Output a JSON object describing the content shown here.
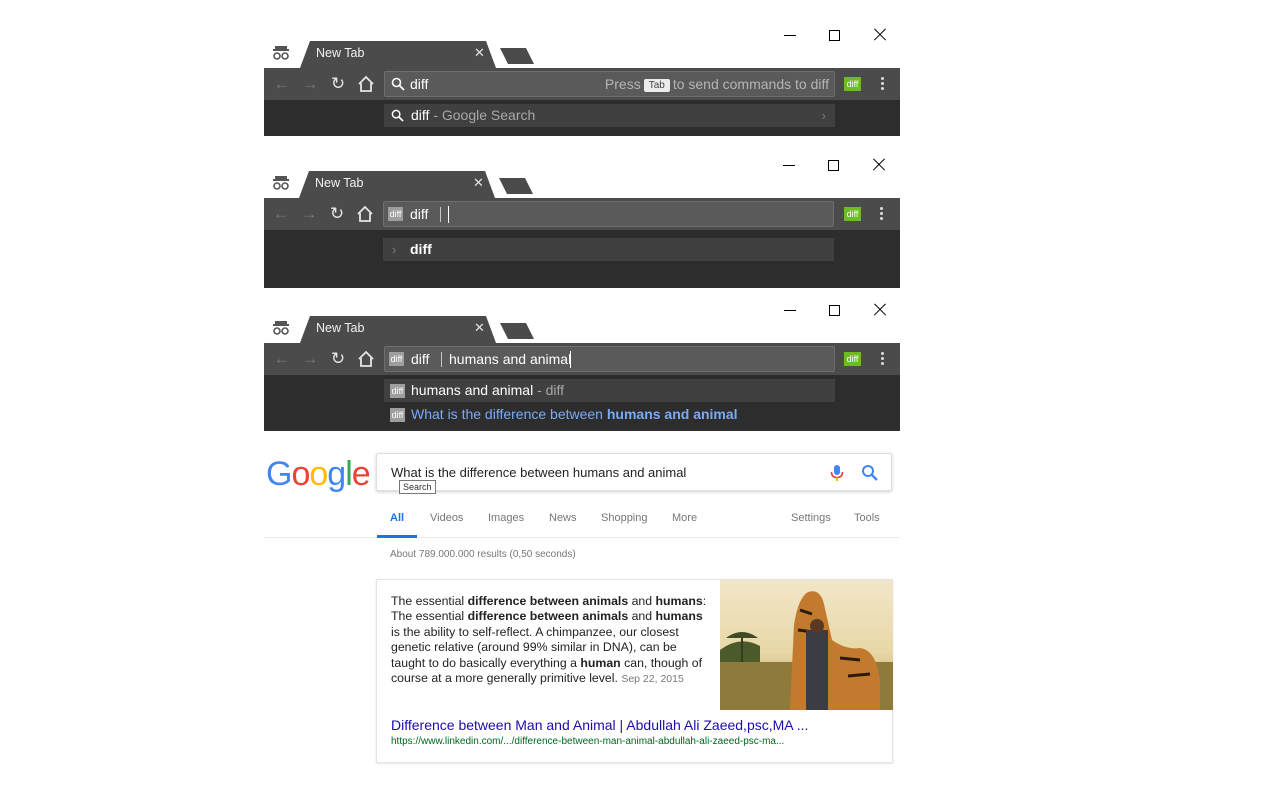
{
  "windows": [
    {
      "tab_title": "New Tab",
      "omnibox_text": "diff",
      "omnibox_hint_before": "Press",
      "omnibox_hint_key": "Tab",
      "omnibox_hint_after": "to send commands to diff",
      "extension_label": "diff",
      "suggestion_bold": "diff",
      "suggestion_rest": " - Google Search"
    },
    {
      "tab_title": "New Tab",
      "keyword_chip": "diff",
      "keyword_label": "diff",
      "extension_label": "diff",
      "suggestion": "diff"
    },
    {
      "tab_title": "New Tab",
      "keyword_chip": "diff",
      "keyword_label": "diff",
      "omnibox_query": "humans and animal",
      "extension_label": "diff",
      "suggestions": [
        {
          "chip": "diff",
          "text": "humans and animal",
          "suffix": " - diff"
        },
        {
          "chip": "diff",
          "prefix": "What is the difference between ",
          "bold": "humans and animal"
        }
      ]
    }
  ],
  "google": {
    "logo_letters": [
      "G",
      "o",
      "o",
      "g",
      "l",
      "e"
    ],
    "logo_colors": [
      "#4285f4",
      "#ea4335",
      "#fbbc05",
      "#4285f4",
      "#34a853",
      "#ea4335"
    ],
    "query": "What is the difference between humans and animal",
    "tooltip": "Search",
    "tabs": [
      "All",
      "Videos",
      "Images",
      "News",
      "Shopping",
      "More"
    ],
    "tools": [
      "Settings",
      "Tools"
    ],
    "stats": "About 789.000.000 results (0,50 seconds)",
    "snippet": {
      "parts": [
        {
          "t": "The essential ",
          "b": false
        },
        {
          "t": "difference between animals",
          "b": true
        },
        {
          "t": " and ",
          "b": false
        },
        {
          "t": "humans",
          "b": true
        },
        {
          "t": ": The essential ",
          "b": false
        },
        {
          "t": "difference between animals",
          "b": true
        },
        {
          "t": " and ",
          "b": false
        },
        {
          "t": "humans",
          "b": true
        },
        {
          "t": " is the ability to self-reflect. A chimpanzee, our closest genetic relative (around 99% similar in DNA), can be taught to do basically everything a ",
          "b": false
        },
        {
          "t": "human",
          "b": true
        },
        {
          "t": " can, though of course at a more generally primitive level.",
          "b": false
        }
      ],
      "date": "Sep 22, 2015",
      "title": "Difference between Man and Animal | Abdullah Ali Zaeed,psc,MA ...",
      "url": "https://www.linkedin.com/.../difference-between-man-animal-abdullah-ali-zaeed-psc-ma..."
    }
  }
}
